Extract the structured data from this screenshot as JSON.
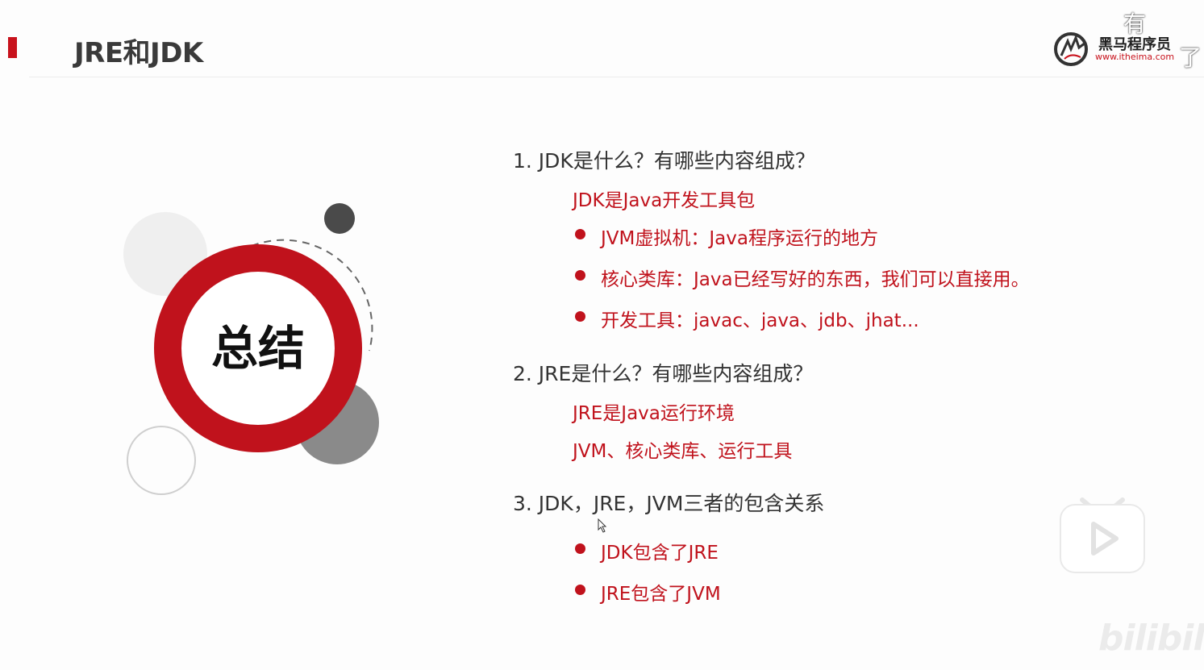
{
  "header": {
    "title": "JRE和JDK",
    "logo_name": "黑马程序员",
    "logo_url": "www.itheima.com"
  },
  "danmaku": [
    "有",
    "了"
  ],
  "summary_label": "总结",
  "sections": [
    {
      "question": "1.  JDK是什么？有哪些内容组成？",
      "answer": "JDK是Java开发工具包",
      "bullets": [
        "JVM虚拟机：Java程序运行的地方",
        "核心类库：Java已经写好的东西，我们可以直接用。",
        "开发工具：javac、java、jdb、jhat..."
      ]
    },
    {
      "question": "2.  JRE是什么？有哪些内容组成？",
      "answer_lines": [
        "JRE是Java运行环境",
        "JVM、核心类库、运行工具"
      ]
    },
    {
      "question": "3.  JDK，JRE，JVM三者的包含关系",
      "bullets": [
        "JDK包含了JRE",
        "JRE包含了JVM"
      ]
    }
  ],
  "watermark": "bilibili",
  "colors": {
    "accent": "#c8121c",
    "text": "#333333",
    "muted": "#8a8a8a"
  },
  "icons": [
    "itheima-logo-icon",
    "play-icon",
    "cursor-icon"
  ]
}
